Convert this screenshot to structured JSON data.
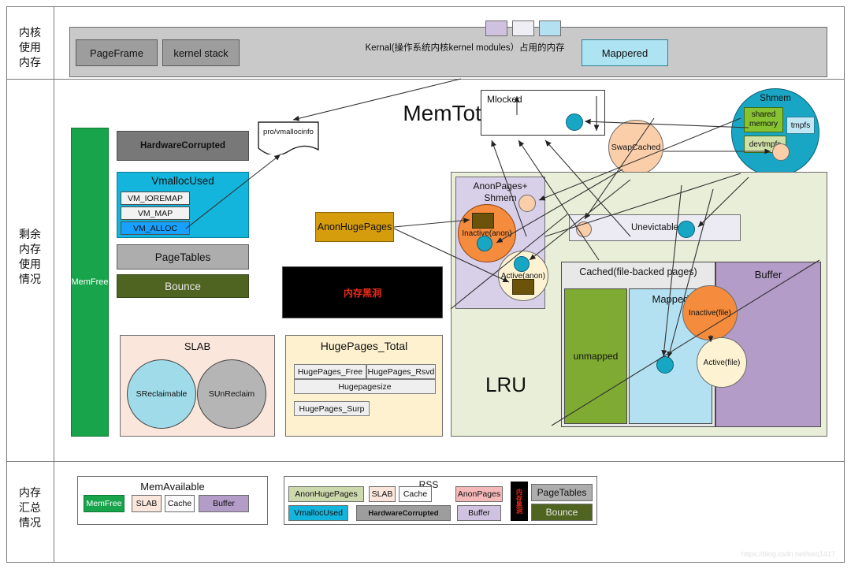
{
  "rows": {
    "kernel_label": "内核\n使用\n内存",
    "remain_label": "剩余\n内存\n使用\n情况",
    "summary_label": "内存\n汇总\n情况"
  },
  "kernel": {
    "pageframe": "PageFrame",
    "kernel_stack": "kernel stack",
    "description": "Kernal(操作系统内核kernel modules）占用的内存",
    "mappered": "Mappered"
  },
  "main": {
    "memtotal": "MemTotal",
    "memfree": "MemFree",
    "hardware_corrupted": "HardwareCorrupted",
    "vmalloc": {
      "title": "VmallocUsed",
      "rows": [
        "VM_IOREMAP",
        "VM_MAP",
        "VM_ALLOC"
      ]
    },
    "pagetables": "PageTables",
    "bounce": "Bounce",
    "blackhole": "内存黑洞",
    "vmallocinfo": "pro/vmallocinfo",
    "anonhugepages": "AnonHugePages",
    "slab": {
      "title": "SLAB",
      "sreclaimable": "SReclaimable",
      "sunreclaim": "SUnReclaim"
    },
    "hugepages": {
      "title": "HugePages_Total",
      "free": "HugePages_Free",
      "rsvd": "HugePages_Rsvd",
      "size": "Hugepagesize",
      "surp": "HugePages_Surp"
    },
    "mlocked": "Mlocked",
    "swapcached": "SwapCached",
    "shmem": {
      "title": "Shmem",
      "shared_memory": "shared memory",
      "tmpfs": "tmpfs",
      "devtmpfs": "devtmpfs"
    },
    "lru": {
      "label": "LRU",
      "anonpages_title": "AnonPages+ Shmem",
      "inactive_anon": "Inactive(anon)",
      "active_anon": "Active(anon)",
      "unevictable": "Unevictable",
      "cached": "Cached(file-backed pages)",
      "unmapped": "unmapped",
      "mapped": "Mapped",
      "buffer": "Buffer",
      "inactive_file": "Inactive(file)",
      "active_file": "Active(file)"
    }
  },
  "summary": {
    "memavailable": {
      "title": "MemAvailable",
      "items": [
        "MemFree",
        "SLAB",
        "Cache",
        "Buffer"
      ]
    },
    "rss": {
      "label": "RSS",
      "anonhugepages": "AnonHugePages",
      "vmallocused": "VmallocUsed",
      "slab": "SLAB",
      "cache": "Cache",
      "hardware_corrupted": "HardwareCorrupted",
      "anonpages": "AnonPages",
      "buffer": "Buffer",
      "blackhole": "内存黑洞",
      "pagetables": "PageTables",
      "bounce": "Bounce"
    }
  },
  "watermark": "https://blog.csdn.net/wxq1417"
}
